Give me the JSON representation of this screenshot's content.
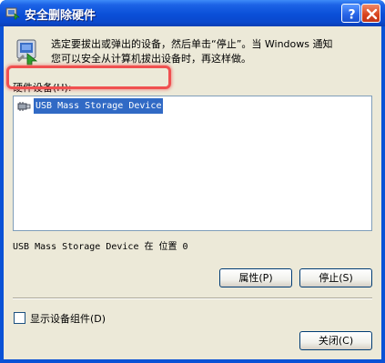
{
  "window": {
    "title": "安全删除硬件",
    "help_glyph": "?",
    "close_glyph": "✕"
  },
  "info": {
    "icon": "safely-remove-hardware-icon",
    "text": "选定要拔出或弹出的设备，然后单击“停止”。当 Windows 通知\n您可以安全从计算机拔出设备时，再这样做。"
  },
  "devices": {
    "label": "硬件设备(H):",
    "items": [
      {
        "label": "USB Mass Storage Device",
        "icon": "usb-icon",
        "selected": true
      }
    ],
    "status": "USB Mass Storage Device 在 位置 0"
  },
  "buttons": {
    "properties": "属性(P)",
    "stop": "停止(S)",
    "close": "关闭(C)"
  },
  "options": {
    "show_components_label": "显示设备组件(D)",
    "show_components_checked": false
  },
  "colors": {
    "title_bar": "#0a4fd8",
    "dialog_bg": "#ece9d8",
    "selection": "#316ac5",
    "highlight_ring": "#f05050"
  }
}
